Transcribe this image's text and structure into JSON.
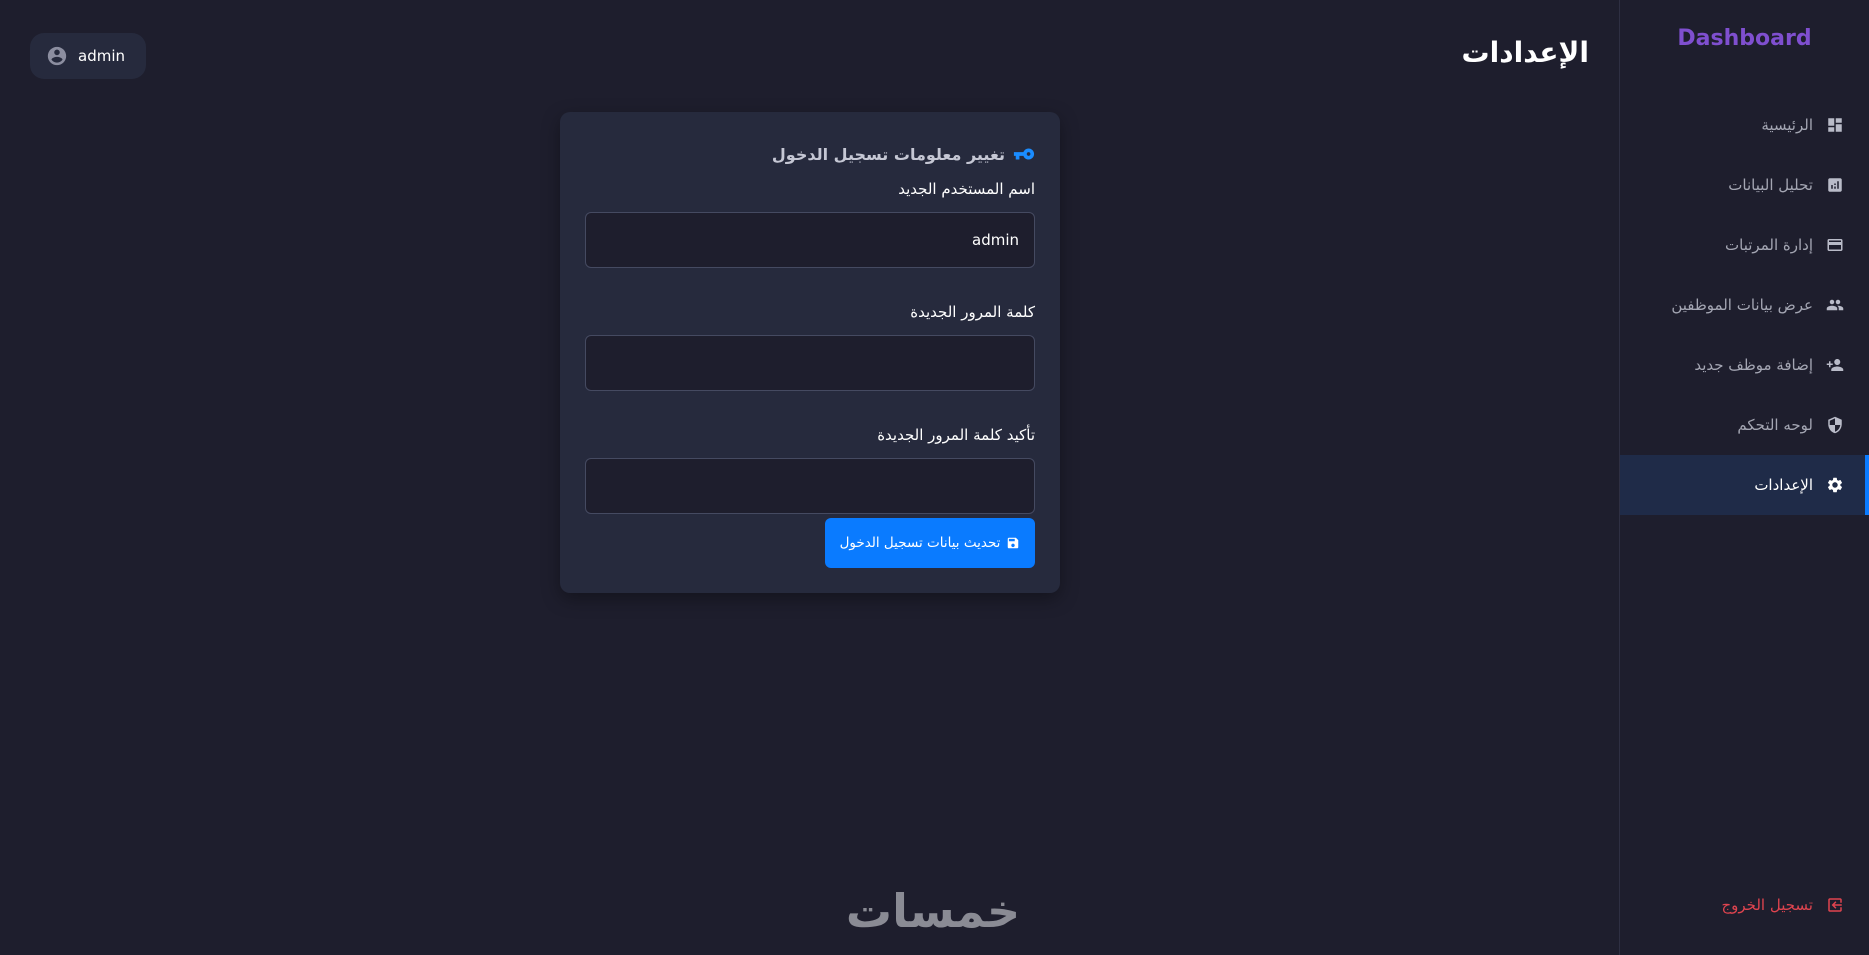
{
  "sidebar": {
    "brand": "Dashboard",
    "items": [
      {
        "label": "الرئيسية",
        "icon": "dashboard-icon",
        "active": false
      },
      {
        "label": "تحليل البيانات",
        "icon": "analytics-icon",
        "active": false
      },
      {
        "label": "إدارة المرتبات",
        "icon": "credit-card-icon",
        "active": false
      },
      {
        "label": "عرض بيانات الموظفين",
        "icon": "people-icon",
        "active": false
      },
      {
        "label": "إضافة موظف جديد",
        "icon": "person-add-icon",
        "active": false
      },
      {
        "label": "لوحه التحكم",
        "icon": "shield-icon",
        "active": false
      },
      {
        "label": "الإعدادات",
        "icon": "gear-icon",
        "active": true
      }
    ],
    "logout_label": "تسجيل الخروج"
  },
  "header": {
    "title": "الإعدادات",
    "user_name": "admin"
  },
  "card": {
    "title": "تغيير معلومات تسجيل الدخول",
    "username_label": "اسم المستخدم الجديد",
    "username_value": "admin",
    "password_label": "كلمة المرور الجديدة",
    "password_value": "",
    "confirm_label": "تأكيد كلمة المرور الجديدة",
    "confirm_value": "",
    "submit_label": "تحديث بيانات تسجيل الدخول"
  },
  "footer": {
    "logo_text": "خمسات"
  },
  "colors": {
    "background": "#1e1e2d",
    "card": "#262a3d",
    "accent": "#0a7bff",
    "brand": "#7f4fcf",
    "logout": "#e0444f"
  }
}
